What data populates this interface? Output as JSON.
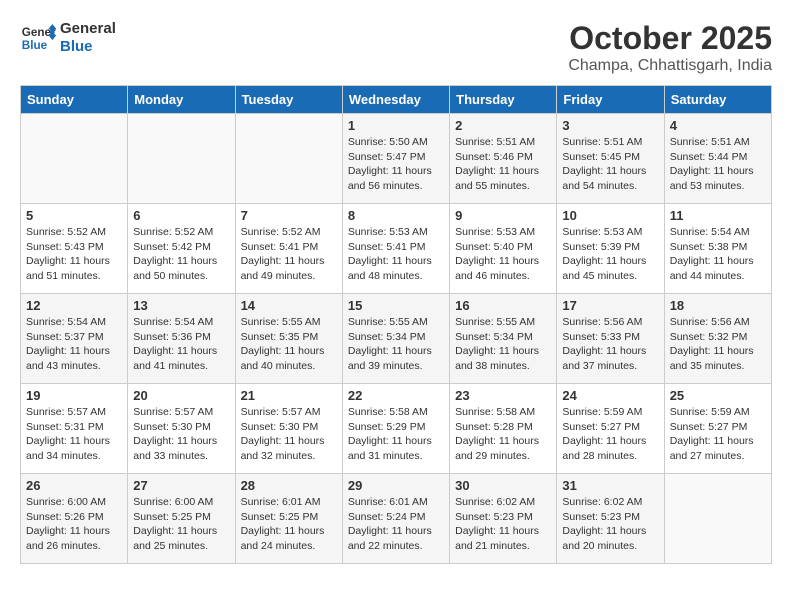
{
  "app": {
    "logo_line1": "General",
    "logo_line2": "Blue"
  },
  "header": {
    "month": "October 2025",
    "location": "Champa, Chhattisgarh, India"
  },
  "weekdays": [
    "Sunday",
    "Monday",
    "Tuesday",
    "Wednesday",
    "Thursday",
    "Friday",
    "Saturday"
  ],
  "weeks": [
    [
      {
        "day": "",
        "info": ""
      },
      {
        "day": "",
        "info": ""
      },
      {
        "day": "",
        "info": ""
      },
      {
        "day": "1",
        "info": "Sunrise: 5:50 AM\nSunset: 5:47 PM\nDaylight: 11 hours\nand 56 minutes."
      },
      {
        "day": "2",
        "info": "Sunrise: 5:51 AM\nSunset: 5:46 PM\nDaylight: 11 hours\nand 55 minutes."
      },
      {
        "day": "3",
        "info": "Sunrise: 5:51 AM\nSunset: 5:45 PM\nDaylight: 11 hours\nand 54 minutes."
      },
      {
        "day": "4",
        "info": "Sunrise: 5:51 AM\nSunset: 5:44 PM\nDaylight: 11 hours\nand 53 minutes."
      }
    ],
    [
      {
        "day": "5",
        "info": "Sunrise: 5:52 AM\nSunset: 5:43 PM\nDaylight: 11 hours\nand 51 minutes."
      },
      {
        "day": "6",
        "info": "Sunrise: 5:52 AM\nSunset: 5:42 PM\nDaylight: 11 hours\nand 50 minutes."
      },
      {
        "day": "7",
        "info": "Sunrise: 5:52 AM\nSunset: 5:41 PM\nDaylight: 11 hours\nand 49 minutes."
      },
      {
        "day": "8",
        "info": "Sunrise: 5:53 AM\nSunset: 5:41 PM\nDaylight: 11 hours\nand 48 minutes."
      },
      {
        "day": "9",
        "info": "Sunrise: 5:53 AM\nSunset: 5:40 PM\nDaylight: 11 hours\nand 46 minutes."
      },
      {
        "day": "10",
        "info": "Sunrise: 5:53 AM\nSunset: 5:39 PM\nDaylight: 11 hours\nand 45 minutes."
      },
      {
        "day": "11",
        "info": "Sunrise: 5:54 AM\nSunset: 5:38 PM\nDaylight: 11 hours\nand 44 minutes."
      }
    ],
    [
      {
        "day": "12",
        "info": "Sunrise: 5:54 AM\nSunset: 5:37 PM\nDaylight: 11 hours\nand 43 minutes."
      },
      {
        "day": "13",
        "info": "Sunrise: 5:54 AM\nSunset: 5:36 PM\nDaylight: 11 hours\nand 41 minutes."
      },
      {
        "day": "14",
        "info": "Sunrise: 5:55 AM\nSunset: 5:35 PM\nDaylight: 11 hours\nand 40 minutes."
      },
      {
        "day": "15",
        "info": "Sunrise: 5:55 AM\nSunset: 5:34 PM\nDaylight: 11 hours\nand 39 minutes."
      },
      {
        "day": "16",
        "info": "Sunrise: 5:55 AM\nSunset: 5:34 PM\nDaylight: 11 hours\nand 38 minutes."
      },
      {
        "day": "17",
        "info": "Sunrise: 5:56 AM\nSunset: 5:33 PM\nDaylight: 11 hours\nand 37 minutes."
      },
      {
        "day": "18",
        "info": "Sunrise: 5:56 AM\nSunset: 5:32 PM\nDaylight: 11 hours\nand 35 minutes."
      }
    ],
    [
      {
        "day": "19",
        "info": "Sunrise: 5:57 AM\nSunset: 5:31 PM\nDaylight: 11 hours\nand 34 minutes."
      },
      {
        "day": "20",
        "info": "Sunrise: 5:57 AM\nSunset: 5:30 PM\nDaylight: 11 hours\nand 33 minutes."
      },
      {
        "day": "21",
        "info": "Sunrise: 5:57 AM\nSunset: 5:30 PM\nDaylight: 11 hours\nand 32 minutes."
      },
      {
        "day": "22",
        "info": "Sunrise: 5:58 AM\nSunset: 5:29 PM\nDaylight: 11 hours\nand 31 minutes."
      },
      {
        "day": "23",
        "info": "Sunrise: 5:58 AM\nSunset: 5:28 PM\nDaylight: 11 hours\nand 29 minutes."
      },
      {
        "day": "24",
        "info": "Sunrise: 5:59 AM\nSunset: 5:27 PM\nDaylight: 11 hours\nand 28 minutes."
      },
      {
        "day": "25",
        "info": "Sunrise: 5:59 AM\nSunset: 5:27 PM\nDaylight: 11 hours\nand 27 minutes."
      }
    ],
    [
      {
        "day": "26",
        "info": "Sunrise: 6:00 AM\nSunset: 5:26 PM\nDaylight: 11 hours\nand 26 minutes."
      },
      {
        "day": "27",
        "info": "Sunrise: 6:00 AM\nSunset: 5:25 PM\nDaylight: 11 hours\nand 25 minutes."
      },
      {
        "day": "28",
        "info": "Sunrise: 6:01 AM\nSunset: 5:25 PM\nDaylight: 11 hours\nand 24 minutes."
      },
      {
        "day": "29",
        "info": "Sunrise: 6:01 AM\nSunset: 5:24 PM\nDaylight: 11 hours\nand 22 minutes."
      },
      {
        "day": "30",
        "info": "Sunrise: 6:02 AM\nSunset: 5:23 PM\nDaylight: 11 hours\nand 21 minutes."
      },
      {
        "day": "31",
        "info": "Sunrise: 6:02 AM\nSunset: 5:23 PM\nDaylight: 11 hours\nand 20 minutes."
      },
      {
        "day": "",
        "info": ""
      }
    ]
  ]
}
